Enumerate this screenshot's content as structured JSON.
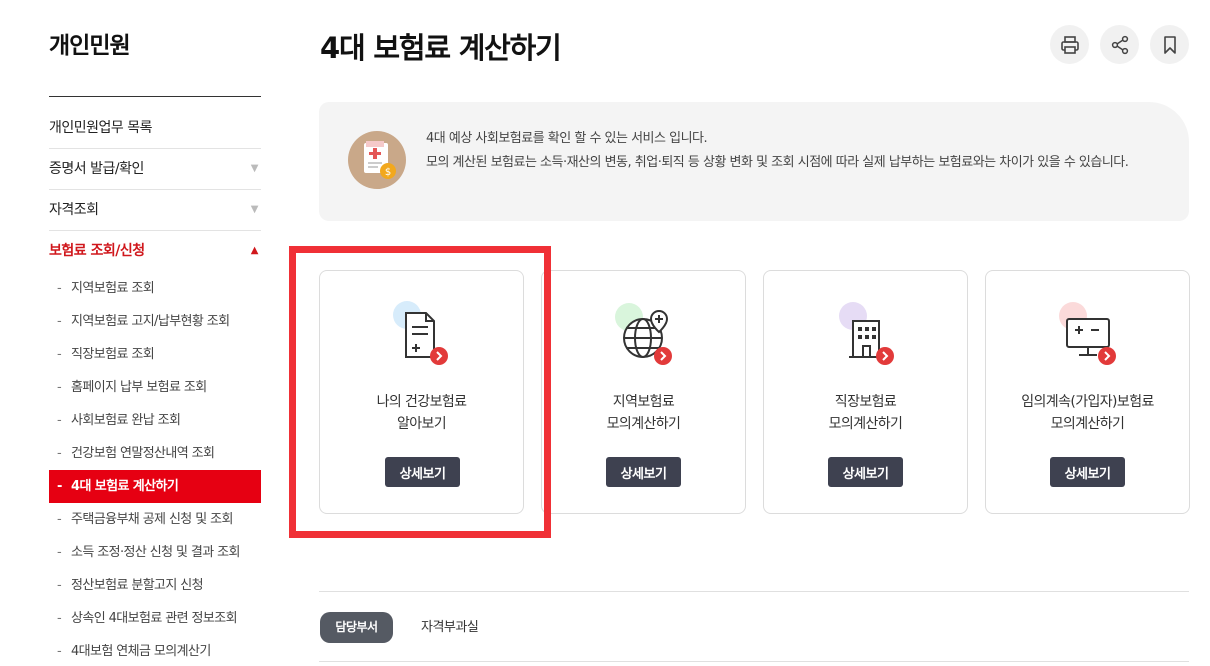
{
  "sidebar": {
    "title": "개인민원",
    "menu": [
      {
        "label": "개인민원업무 목록",
        "caret": ""
      },
      {
        "label": "증명서 발급/확인",
        "caret": "▼"
      },
      {
        "label": "자격조회",
        "caret": "▼"
      },
      {
        "label": "보험료 조회/신청",
        "caret": "▲"
      }
    ],
    "submenu": [
      {
        "dash": "-",
        "label": "지역보험료 조회"
      },
      {
        "dash": "-",
        "label": "지역보험료 고지/납부현황 조회"
      },
      {
        "dash": "-",
        "label": "직장보험료 조회"
      },
      {
        "dash": "-",
        "label": "홈페이지 납부 보험료 조회"
      },
      {
        "dash": "-",
        "label": "사회보험료 완납 조회"
      },
      {
        "dash": "-",
        "label": "건강보험 연말정산내역 조회"
      },
      {
        "dash": "-",
        "label": "4대 보험료 계산하기"
      },
      {
        "dash": "-",
        "label": "주택금융부채 공제 신청 및 조회"
      },
      {
        "dash": "-",
        "label": "소득 조정·정산 신청 및 결과 조회"
      },
      {
        "dash": "-",
        "label": "정산보험료 분할고지 신청"
      },
      {
        "dash": "-",
        "label": "상속인 4대보험료 관련 정보조회"
      },
      {
        "dash": "-",
        "label": "4대보험 연체금 모의계산기"
      }
    ]
  },
  "page": {
    "title": "4대 보험료 계산하기"
  },
  "toolbar": {
    "icons": [
      "print-icon",
      "share-icon",
      "bookmark-icon"
    ]
  },
  "info": {
    "line1": "4대 예상 사회보험료를 확인 할 수 있는 서비스 입니다.",
    "line2": "모의 계산된 보험료는 소득·재산의 변동, 취업·퇴직 등 상황 변화 및 조회 시점에 따라 실제 납부하는 보험료와는 차이가 있을 수 있습니다."
  },
  "cards": [
    {
      "line1": "나의 건강보험료",
      "line2": "알아보기",
      "button": "상세보기",
      "icon": "document-icon",
      "accent": "#d7ecfb"
    },
    {
      "line1": "지역보험료",
      "line2": "모의계산하기",
      "button": "상세보기",
      "icon": "globe-icon",
      "accent": "#d9f5dc"
    },
    {
      "line1": "직장보험료",
      "line2": "모의계산하기",
      "button": "상세보기",
      "icon": "building-icon",
      "accent": "#e6dcf5"
    },
    {
      "line1": "임의계속(가입자)보험료",
      "line2": "모의계산하기",
      "button": "상세보기",
      "icon": "calculator-monitor-icon",
      "accent": "#fbdada"
    }
  ],
  "tabs": {
    "active": "담당부서",
    "other": "자격부과실"
  },
  "colors": {
    "accent_red": "#e60012",
    "highlight_red": "#f03036",
    "button_dark": "#3e4150"
  }
}
